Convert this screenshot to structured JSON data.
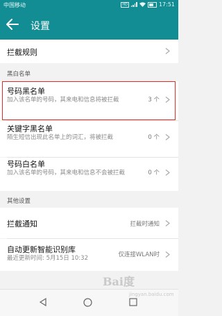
{
  "status_bar": {
    "carrier": "中国移动",
    "hd": "HD",
    "time": "17:51"
  },
  "header": {
    "title": "设置",
    "back_icon": "arrow-left-icon"
  },
  "rows": {
    "intercept_rules": {
      "title": "拦截规则"
    },
    "phone_blacklist": {
      "title": "号码黑名单",
      "subtitle": "加入该名单的号码，其来电和信息将被拦截",
      "value": "3 个"
    },
    "keyword_blacklist": {
      "title": "关键字黑名单",
      "subtitle": "陌生短信出现此名单上的词汇，将被拦截",
      "value": "0 个"
    },
    "phone_whitelist": {
      "title": "号码白名单",
      "subtitle": "加入该名单的号码，其来电和信息不会被拦截",
      "value": "0 个"
    },
    "intercept_notify": {
      "title": "拦截通知",
      "value": "拦截时通知"
    },
    "auto_update": {
      "title": "自动更新智能识别库",
      "subtitle": "最近更新时间: 5月15日 10:32",
      "value": "仅连接WLAN时"
    }
  },
  "sections": {
    "black_white": "黑白名单",
    "other": "其他设置"
  },
  "watermark": {
    "text": "Bai度",
    "sub": "jingyan.baidu.com"
  },
  "nav_bar": {
    "back_icon": "triangle-back-icon",
    "home_icon": "circle-home-icon",
    "recents_icon": "square-recents-icon"
  },
  "colors": {
    "accent": "#138d94",
    "highlight": "#e02b2b"
  }
}
